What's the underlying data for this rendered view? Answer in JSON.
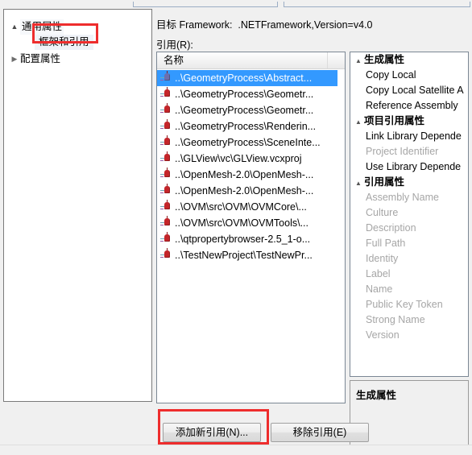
{
  "window": {
    "locale": "zh-CN",
    "accent_highlight": "#3399ff",
    "marker_color": "#ee2d2d"
  },
  "tree": {
    "items": [
      {
        "label": "通用属性",
        "expander": "▲",
        "level": 0,
        "expanded": true
      },
      {
        "label": "框架和引用",
        "expander": "",
        "level": 1,
        "selected": true
      },
      {
        "label": "配置属性",
        "expander": "▶",
        "level": 0,
        "expanded": false
      }
    ]
  },
  "main": {
    "target_framework_label": "目标 Framework:",
    "target_framework_value": ".NETFramework,Version=v4.0",
    "references_label": "引用(R):"
  },
  "reference_list": {
    "column_header": "名称",
    "items": [
      {
        "name": "..\\GeometryProcess\\Abstract...",
        "selected": true
      },
      {
        "name": "..\\GeometryProcess\\Geometr...",
        "selected": false
      },
      {
        "name": "..\\GeometryProcess\\Geometr...",
        "selected": false
      },
      {
        "name": "..\\GeometryProcess\\Renderin...",
        "selected": false
      },
      {
        "name": "..\\GeometryProcess\\SceneInte...",
        "selected": false
      },
      {
        "name": "..\\GLView\\vc\\GLView.vcxproj",
        "selected": false
      },
      {
        "name": "..\\OpenMesh-2.0\\OpenMesh-...",
        "selected": false
      },
      {
        "name": "..\\OpenMesh-2.0\\OpenMesh-...",
        "selected": false
      },
      {
        "name": "..\\OVM\\src\\OVM\\OVMCore\\...",
        "selected": false
      },
      {
        "name": "..\\OVM\\src\\OVM\\OVMTools\\...",
        "selected": false
      },
      {
        "name": "..\\qtpropertybrowser-2.5_1-o...",
        "selected": false
      },
      {
        "name": "..\\TestNewProject\\TestNewPr...",
        "selected": false
      }
    ]
  },
  "properties": {
    "rows": [
      {
        "kind": "category",
        "label": "生成属性",
        "expander": "▲"
      },
      {
        "kind": "item",
        "label": "Copy Local",
        "enabled": true
      },
      {
        "kind": "item",
        "label": "Copy Local Satellite A",
        "enabled": true
      },
      {
        "kind": "item",
        "label": "Reference Assembly ",
        "enabled": true
      },
      {
        "kind": "category",
        "label": "项目引用属性",
        "expander": "▲"
      },
      {
        "kind": "item",
        "label": "Link Library Depende",
        "enabled": true
      },
      {
        "kind": "item",
        "label": "Project Identifier",
        "enabled": false
      },
      {
        "kind": "item",
        "label": "Use Library Depende",
        "enabled": true
      },
      {
        "kind": "category",
        "label": "引用属性",
        "expander": "▲"
      },
      {
        "kind": "item",
        "label": "Assembly Name",
        "enabled": false
      },
      {
        "kind": "item",
        "label": "Culture",
        "enabled": false
      },
      {
        "kind": "item",
        "label": "Description",
        "enabled": false
      },
      {
        "kind": "item",
        "label": "Full Path",
        "enabled": false
      },
      {
        "kind": "item",
        "label": "Identity",
        "enabled": false
      },
      {
        "kind": "item",
        "label": "Label",
        "enabled": false
      },
      {
        "kind": "item",
        "label": "Name",
        "enabled": false
      },
      {
        "kind": "item",
        "label": "Public Key Token",
        "enabled": false
      },
      {
        "kind": "item",
        "label": "Strong Name",
        "enabled": false
      },
      {
        "kind": "item",
        "label": "Version",
        "enabled": false
      }
    ]
  },
  "description_pane": {
    "title": "生成属性"
  },
  "buttons": {
    "add_reference": "添加新引用(N)...",
    "remove_reference": "移除引用(E)"
  }
}
